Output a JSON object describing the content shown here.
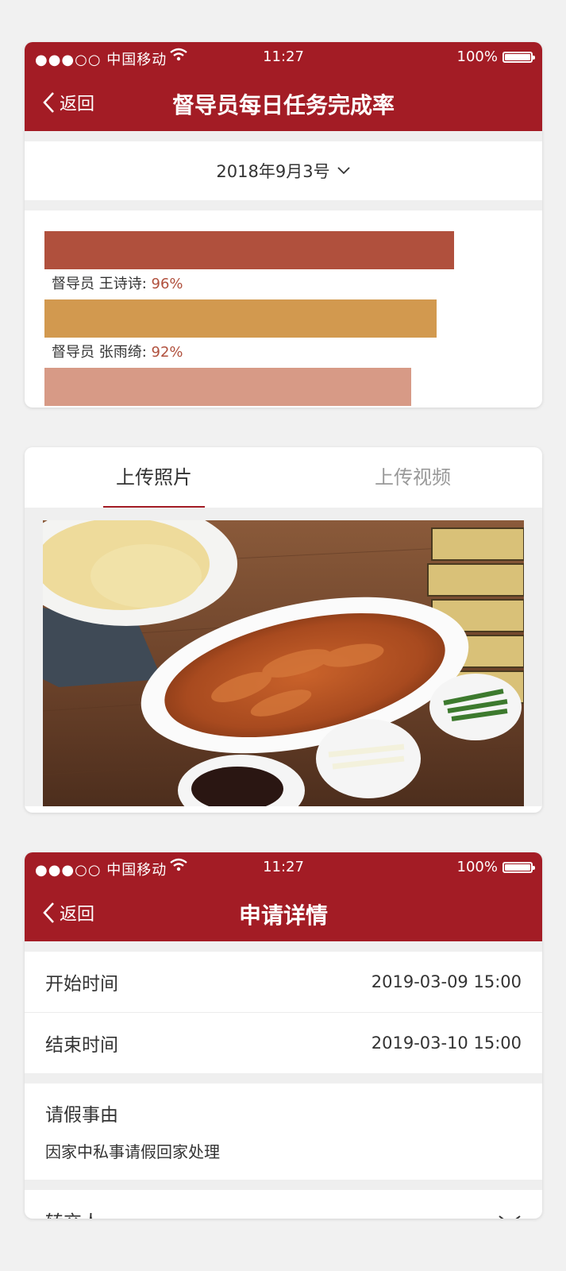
{
  "screen1": {
    "status": {
      "carrier": "●●●○○ 中国移动",
      "time": "11:27",
      "battery": "100%"
    },
    "nav": {
      "back_label": "返回",
      "title": "督导员每日任务完成率"
    },
    "date_selector": "2018年9月3号",
    "chart_data": {
      "type": "bar",
      "orientation": "horizontal",
      "categories": [
        "督导员 王诗诗",
        "督导员 张雨绮",
        ""
      ],
      "values": [
        96,
        92,
        86
      ],
      "unit": "%",
      "colors": [
        "#b0503d",
        "#d2994f",
        "#d79a86"
      ],
      "xlim": [
        0,
        100
      ]
    },
    "bar_labels": [
      {
        "name": "督导员 王诗诗: ",
        "pct": "96%"
      },
      {
        "name": "督导员 张雨绮: ",
        "pct": "92%"
      }
    ]
  },
  "screen2": {
    "tabs": [
      {
        "label": "上传照片",
        "active": true
      },
      {
        "label": "上传视频",
        "active": false
      }
    ],
    "photo_alt": "peking-duck-photo"
  },
  "screen3": {
    "status": {
      "carrier": "●●●○○ 中国移动",
      "time": "11:27",
      "battery": "100%"
    },
    "nav": {
      "back_label": "返回",
      "title": "申请详情"
    },
    "start": {
      "label": "开始时间",
      "value": "2019-03-09 15:00"
    },
    "end": {
      "label": "结束时间",
      "value": "2019-03-10 15:00"
    },
    "reason": {
      "label": "请假事由",
      "text": "因家中私事请假回家处理"
    },
    "handover": {
      "label": "转交人"
    }
  },
  "colors": {
    "brand": "#a31c25",
    "accent_pct": "#b0503d"
  }
}
